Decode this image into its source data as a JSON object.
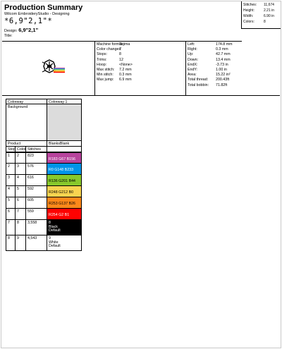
{
  "header": {
    "title": "Production Summary",
    "subtitle": "Wilcom EmbroideryStudio - Designing",
    "design_name_display": "*6,9\"2,1\"*",
    "design_label": "Design:",
    "design_value": "6,9\"2,1\"",
    "title_label": "Title:"
  },
  "summary_box": [
    {
      "label": "Stitches:",
      "value": "11,674"
    },
    {
      "label": "Height:",
      "value": "2.21 in"
    },
    {
      "label": "Width:",
      "value": "6.90 in"
    },
    {
      "label": "Colors:",
      "value": "8"
    }
  ],
  "machine_info": [
    {
      "label": "Machine format:",
      "value": "Tajima"
    },
    {
      "label": "Color changes:",
      "value": "7"
    },
    {
      "label": "Stops:",
      "value": "8"
    },
    {
      "label": "Trims:",
      "value": "12"
    },
    {
      "label": "Hoop:",
      "value": "<None>"
    },
    {
      "label": "Max stitch:",
      "value": "7.2 mm"
    },
    {
      "label": "Min stitch:",
      "value": "0.3 mm"
    },
    {
      "label": "Max jump:",
      "value": "6.9 mm"
    }
  ],
  "position_info": [
    {
      "label": "Left:",
      "value": "174.8 mm"
    },
    {
      "label": "Right:",
      "value": "0.3 mm"
    },
    {
      "label": "Up:",
      "value": "42.7 mm"
    },
    {
      "label": "Down:",
      "value": "13.4 mm"
    },
    {
      "label": "EndX:",
      "value": "-3.73 in"
    },
    {
      "label": "EndY:",
      "value": "1.00 in"
    },
    {
      "label": "Area:",
      "value": "15.22 in²"
    },
    {
      "label": "Total thread:",
      "value": "200.43ft"
    },
    {
      "label": "Total bobbin:",
      "value": "71.82ft"
    }
  ],
  "colorway": {
    "header_left": "Colorway",
    "header_right": "Colorway 1",
    "background_label": "Background",
    "background_color": "#dcdcdc",
    "product_label": "Product",
    "product_value": "BlanksBlank",
    "columns": [
      "Stop",
      "Color",
      "Stitches"
    ],
    "stops": [
      {
        "stop": "1",
        "color": "2",
        "stitches": "823",
        "swatch": "#b7439c",
        "text": "R183 G67 B156",
        "text_color": "#ffffff"
      },
      {
        "stop": "2",
        "color": "3",
        "stitches": "576",
        "swatch": "#0094e9",
        "text": "R0 G148 B233",
        "text_color": "#ffffff"
      },
      {
        "stop": "3",
        "color": "4",
        "stitches": "616",
        "swatch": "#88c92c",
        "text": "R136 G201 B44",
        "text_color": "#000000"
      },
      {
        "stop": "4",
        "color": "5",
        "stitches": "592",
        "swatch": "#f8d450",
        "text": "R248 G212 B0",
        "text_color": "#000000"
      },
      {
        "stop": "5",
        "color": "6",
        "stitches": "605",
        "swatch": "#fd891a",
        "text": "R253 G137 B26",
        "text_color": "#000000"
      },
      {
        "stop": "6",
        "color": "7",
        "stitches": "559",
        "swatch": "#fe0201",
        "text": "R254 G2 B1",
        "text_color": "#ffffff"
      },
      {
        "stop": "7",
        "color": "8",
        "stitches": "3,558",
        "swatch": "#000000",
        "text": "8\nBlack\nDefault",
        "text_color": "#ffffff"
      },
      {
        "stop": "8",
        "color": "9",
        "stitches": "4,543",
        "swatch": "#ffffff",
        "text": "9\nWhite\nDefault",
        "text_color": "#000000"
      }
    ]
  }
}
